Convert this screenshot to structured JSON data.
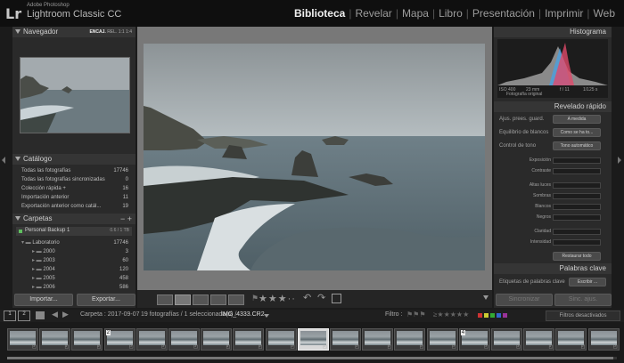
{
  "app": {
    "logo": "Lr",
    "brand_small": "Adobe Photoshop",
    "brand_big": "Lightroom Classic CC"
  },
  "modules": [
    "Biblioteca",
    "Revelar",
    "Mapa",
    "Libro",
    "Presentación",
    "Imprimir",
    "Web"
  ],
  "active_module": "Biblioteca",
  "left": {
    "navigator": {
      "title": "Navegador",
      "zoom_opts": [
        "ENCAJ.",
        "REL.",
        "1:1",
        "1:4"
      ]
    },
    "catalog": {
      "title": "Catálogo",
      "items": [
        {
          "label": "Todas las fotografías",
          "count": "17746"
        },
        {
          "label": "Todas las fotografías sincronizadas",
          "count": "0"
        },
        {
          "label": "Colección rápida +",
          "count": "16"
        },
        {
          "label": "Importación anterior",
          "count": "11"
        },
        {
          "label": "Exportación anterior como catál...",
          "count": "19"
        }
      ]
    },
    "folders": {
      "title": "Carpetas",
      "volume": {
        "label": "Personal Backup 1",
        "count": "0.6 / 1 TB"
      },
      "root": {
        "label": "Laboratorio",
        "count": "17746"
      },
      "subs": [
        {
          "label": "2000",
          "count": "3"
        },
        {
          "label": "2003",
          "count": "60"
        },
        {
          "label": "2004",
          "count": "120"
        },
        {
          "label": "2005",
          "count": "458"
        },
        {
          "label": "2006",
          "count": "586"
        }
      ]
    },
    "import_btn": "Importar...",
    "export_btn": "Exportar..."
  },
  "right": {
    "histogram": {
      "title": "Histograma",
      "iso": "ISO 400",
      "focal": "23 mm",
      "aperture": "f / 11",
      "shutter": "1/125 s",
      "original": "Fotografía original"
    },
    "quick_develop": {
      "title": "Revelado rápido",
      "preset_label": "Ajus. prees. guard.",
      "preset_value": "A medida",
      "wb_label": "Equilibrio de blancos",
      "wb_value": "Como se ha to...",
      "tone_label": "Control de tono",
      "tone_value": "Tono automático",
      "sliders": [
        "Exposición",
        "Contraste",
        "Altas luces",
        "Sombras",
        "Blancos",
        "Negros",
        "Claridad",
        "Intensidad"
      ],
      "reset_btn": "Restaurar todo"
    },
    "keywords": {
      "title": "Palabras clave",
      "label": "Etiquetas de palabras clave",
      "value": "Escribir ..."
    },
    "sync_btn": "Sincronizar",
    "sync_settings_btn": "Sinc. ajus."
  },
  "toolbar": {
    "rating": 3
  },
  "filmstrip_bar": {
    "pages": [
      "1",
      "2"
    ],
    "folder": "Carpeta : 2017-09-07",
    "info": "19 fotografías / 1 seleccionada(s) /",
    "filename": "IMG_4333.CR2",
    "filter_label": "Filtro :",
    "filter_value": "Filtros desactivados"
  },
  "filmstrip": {
    "count": 19,
    "selected_index": 9,
    "badges": [
      {
        "index": 3,
        "text": "2"
      },
      {
        "index": 14,
        "text": "4"
      }
    ]
  },
  "colors": {
    "accent": "#ffffff",
    "panel_bg": "#2a2a2a",
    "header_bg": "#353535",
    "background": "#1b1b1b"
  }
}
